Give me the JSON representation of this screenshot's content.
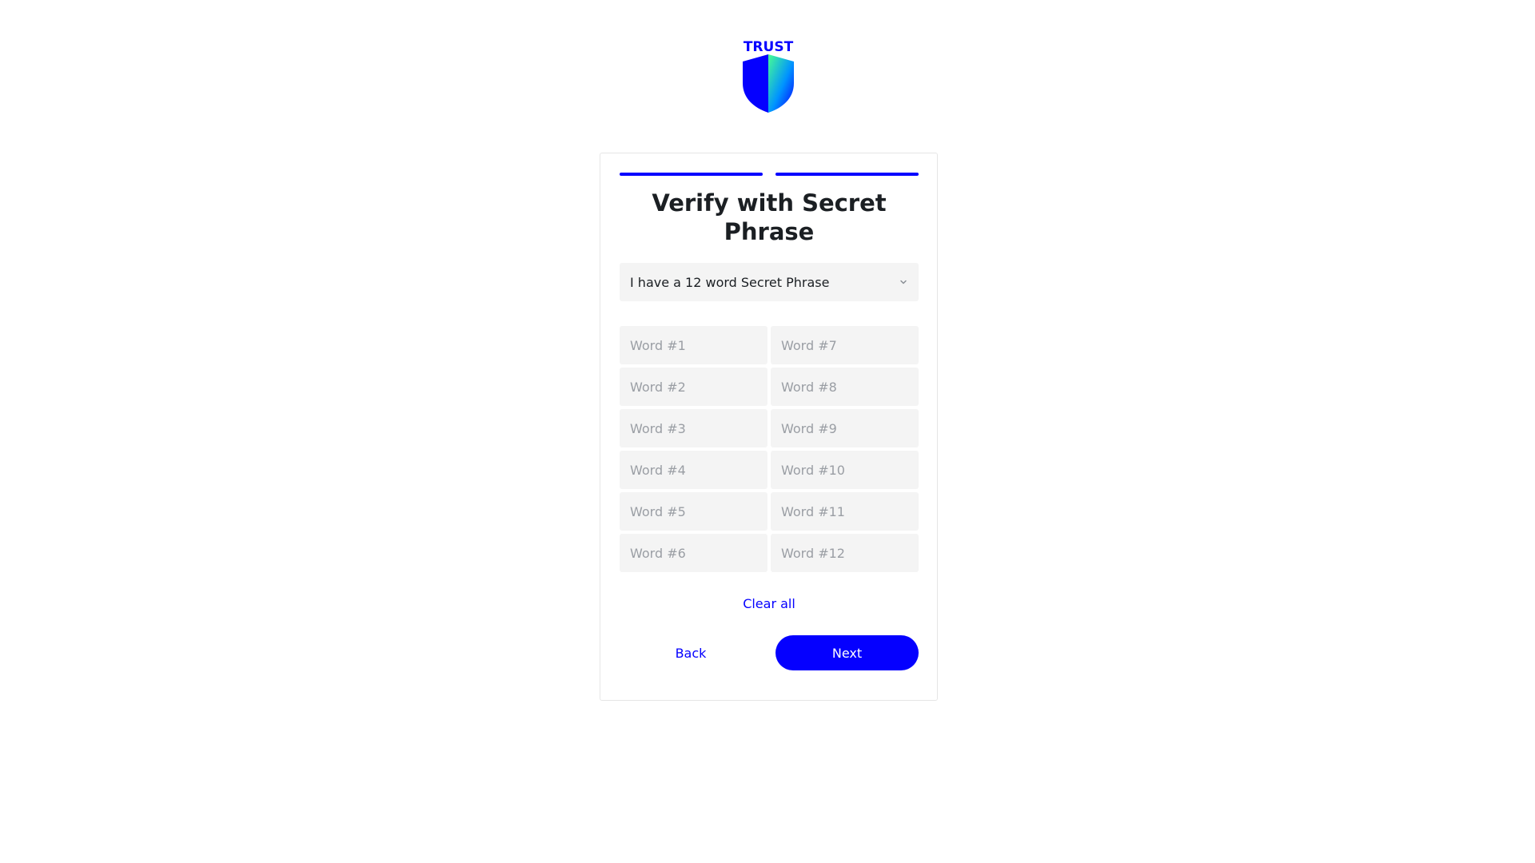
{
  "brand": {
    "logo_text": "TRUST",
    "colors": {
      "primary": "#0500ff",
      "gradient_end": "#48ff91"
    }
  },
  "progress": {
    "steps_total": 2,
    "steps_completed": 2
  },
  "card": {
    "title": "Verify with Secret Phrase",
    "phrase_select": {
      "value": "I have a 12 word Secret Phrase",
      "icon": "chevron-down-icon"
    },
    "words": [
      {
        "placeholder": "Word #1",
        "value": ""
      },
      {
        "placeholder": "Word #2",
        "value": ""
      },
      {
        "placeholder": "Word #3",
        "value": ""
      },
      {
        "placeholder": "Word #4",
        "value": ""
      },
      {
        "placeholder": "Word #5",
        "value": ""
      },
      {
        "placeholder": "Word #6",
        "value": ""
      },
      {
        "placeholder": "Word #7",
        "value": ""
      },
      {
        "placeholder": "Word #8",
        "value": ""
      },
      {
        "placeholder": "Word #9",
        "value": ""
      },
      {
        "placeholder": "Word #10",
        "value": ""
      },
      {
        "placeholder": "Word #11",
        "value": ""
      },
      {
        "placeholder": "Word #12",
        "value": ""
      }
    ],
    "clear_all_label": "Clear all",
    "back_label": "Back",
    "next_label": "Next"
  }
}
